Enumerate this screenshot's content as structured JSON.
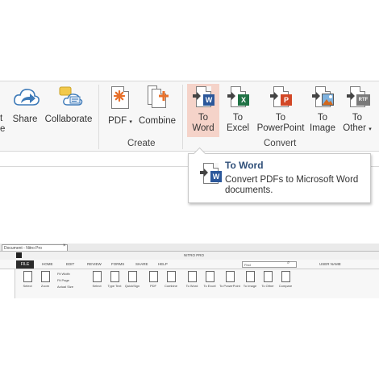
{
  "ribbon": {
    "share": {
      "label": "Share",
      "icon": "cloud-share-icon"
    },
    "collaborate": {
      "label": "Collaborate",
      "icon": "collaborate-icon"
    },
    "left_fragment": [
      "t",
      "e"
    ],
    "create_group": {
      "label": "Create",
      "pdf": {
        "label": "PDF",
        "icon": "pdf-new-icon"
      },
      "combine": {
        "label": "Combine",
        "icon": "combine-icon"
      }
    },
    "convert_group": {
      "label": "Convert",
      "to_word": {
        "line1": "To",
        "line2": "Word",
        "icon": "word-icon",
        "badge": "W",
        "color": "#2b579a"
      },
      "to_excel": {
        "line1": "To",
        "line2": "Excel",
        "icon": "excel-icon",
        "badge": "X",
        "color": "#217346"
      },
      "to_powerpoint": {
        "line1": "To",
        "line2": "PowerPoint",
        "icon": "powerpoint-icon",
        "badge": "P",
        "color": "#d24726"
      },
      "to_image": {
        "line1": "To",
        "line2": "Image",
        "icon": "image-icon"
      },
      "to_other": {
        "line1": "To",
        "line2": "Other",
        "icon": "rtf-icon",
        "badge": "RTF"
      }
    },
    "active_color": "#f5d3c9"
  },
  "tooltip": {
    "title": "To Word",
    "text": "Convert PDFs to Microsoft Word documents."
  },
  "mini_window": {
    "tab_title": "Document - Nitro Pro",
    "menu": [
      "FILE",
      "HOME",
      "EDIT",
      "REVIEW",
      "FORMS",
      "SHARE",
      "HELP"
    ],
    "title": "NITRO PRO",
    "search_placeholder": "Find",
    "user": "USER NAME",
    "buttons": [
      "Select",
      "Zoom",
      "Type Text",
      "QuickSign",
      "PDF",
      "Combine",
      "To Word",
      "To Excel",
      "To PowerPoint",
      "To Image",
      "To Other",
      "Compare"
    ],
    "view_items": [
      "Fit Width",
      "Fit Page",
      "Actual Size"
    ]
  }
}
